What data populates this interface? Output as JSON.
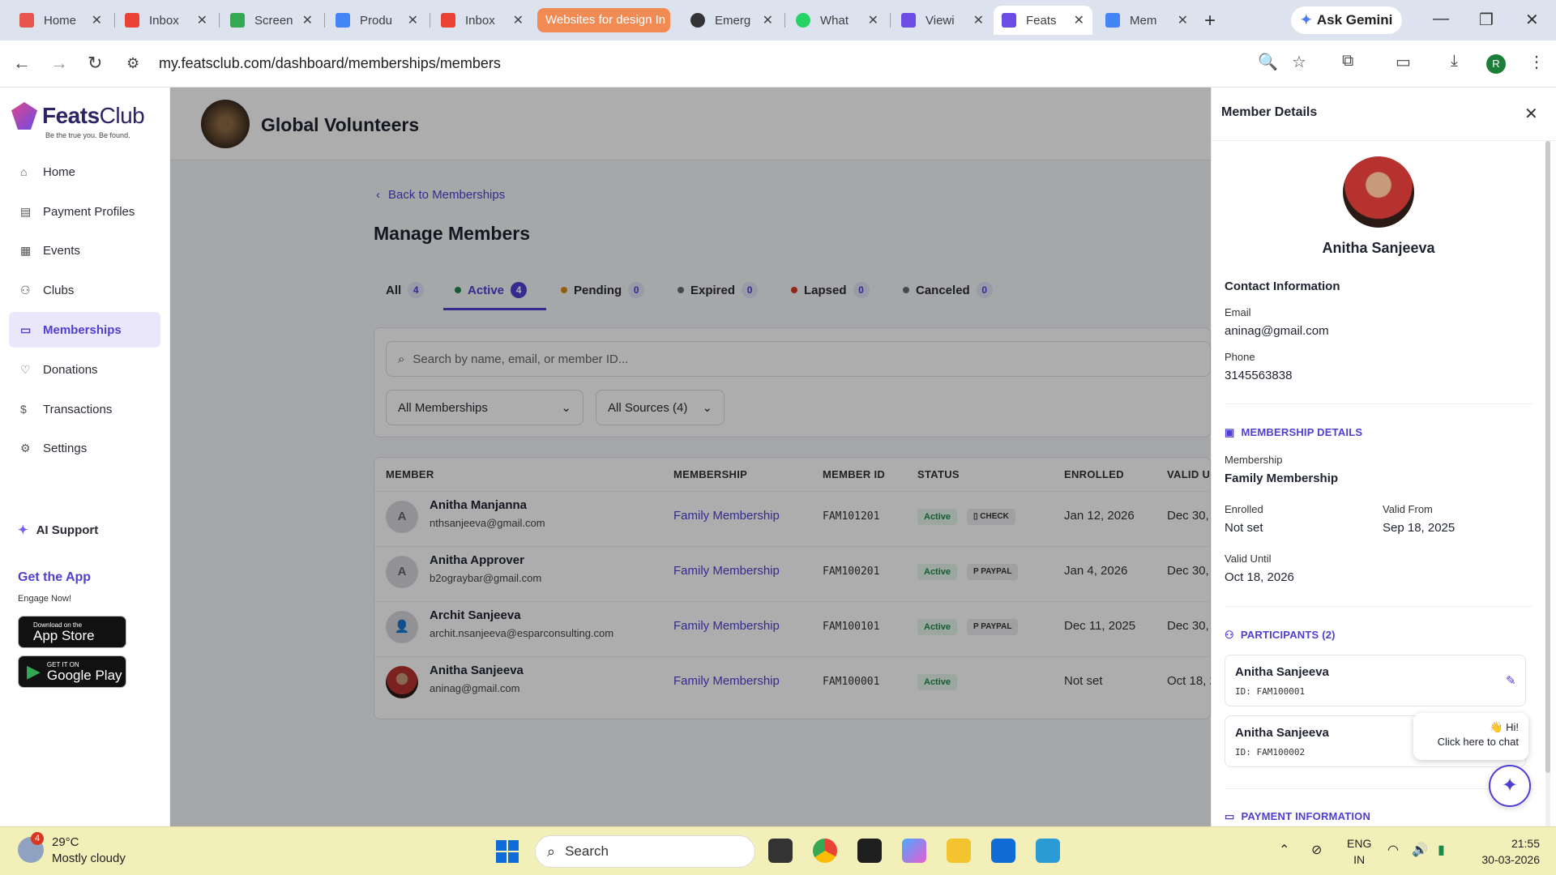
{
  "browser": {
    "tabs": [
      {
        "title": "Home",
        "color": "#e8554e"
      },
      {
        "title": "Inbox",
        "color": "#ea4335"
      },
      {
        "title": "Screen",
        "color": "#34a853"
      },
      {
        "title": "Produ",
        "color": "#4285f4"
      },
      {
        "title": "Inbox",
        "color": "#ea4335"
      },
      {
        "title": "Websites for design In",
        "color": "#f28b53"
      },
      {
        "title": "Emerg",
        "color": "#333333"
      },
      {
        "title": "What",
        "color": "#25d366"
      },
      {
        "title": "Viewi",
        "color": "#6b4de6"
      },
      {
        "title": "Feats",
        "color": "#6b4de6"
      },
      {
        "title": "Mem",
        "color": "#4285f4"
      }
    ],
    "gemini_label": "Ask Gemini",
    "url": "my.featsclub.com/dashboard/memberships/members",
    "profile_initial": "R"
  },
  "sidebar": {
    "brand_bold": "Feats",
    "brand_light": "Club",
    "tagline": "Be the true you. Be found.",
    "items": [
      {
        "label": "Home",
        "icon": "home-icon"
      },
      {
        "label": "Payment Profiles",
        "icon": "payment-icon"
      },
      {
        "label": "Events",
        "icon": "calendar-icon"
      },
      {
        "label": "Clubs",
        "icon": "users-icon"
      },
      {
        "label": "Memberships",
        "icon": "card-icon"
      },
      {
        "label": "Donations",
        "icon": "heart-icon"
      },
      {
        "label": "Transactions",
        "icon": "dollar-icon"
      },
      {
        "label": "Settings",
        "icon": "gear-icon"
      }
    ],
    "ai_support": "AI Support",
    "get_app": "Get the App",
    "engage": "Engage Now!",
    "appstore_small": "Download on the",
    "appstore_big": "App Store",
    "googleplay_small": "GET IT ON",
    "googleplay_big": "Google Play"
  },
  "org": {
    "name": "Global Volunteers"
  },
  "page": {
    "back_label": "Back to Memberships",
    "title": "Manage Members",
    "tabs": [
      {
        "label": "All",
        "count": "4",
        "dot": ""
      },
      {
        "label": "Active",
        "count": "4",
        "dot": "#1e8a4a"
      },
      {
        "label": "Pending",
        "count": "0",
        "dot": "#d88a1a"
      },
      {
        "label": "Expired",
        "count": "0",
        "dot": "#666a75"
      },
      {
        "label": "Lapsed",
        "count": "0",
        "dot": "#d9381e"
      },
      {
        "label": "Canceled",
        "count": "0",
        "dot": "#666a75"
      }
    ],
    "search_placeholder": "Search by name, email, or member ID...",
    "filter_memberships": "All Memberships",
    "filter_sources": "All Sources (4)"
  },
  "table": {
    "headers": [
      "MEMBER",
      "MEMBERSHIP",
      "MEMBER ID",
      "STATUS",
      "ENROLLED",
      "VALID U"
    ],
    "rows": [
      {
        "initial": "A",
        "name": "Anitha Manjanna",
        "email": "nthsanjeeva@gmail.com",
        "membership": "Family Membership",
        "id": "FAM101201",
        "status": "Active",
        "source": "CHECK",
        "enrolled": "Jan 12, 2026",
        "valid": "Dec 30,"
      },
      {
        "initial": "A",
        "name": "Anitha Approver",
        "email": "b2ograybar@gmail.com",
        "membership": "Family Membership",
        "id": "FAM100201",
        "status": "Active",
        "source": "PAYPAL",
        "enrolled": "Jan 4, 2026",
        "valid": "Dec 30,"
      },
      {
        "initial": "",
        "name": "Archit Sanjeeva",
        "email": "archit.nsanjeeva@esparconsulting.com",
        "membership": "Family Membership",
        "id": "FAM100101",
        "status": "Active",
        "source": "PAYPAL",
        "enrolled": "Dec 11, 2025",
        "valid": "Dec 30,"
      },
      {
        "initial": "",
        "name": "Anitha Sanjeeva",
        "email": "aninag@gmail.com",
        "membership": "Family Membership",
        "id": "FAM100001",
        "status": "Active",
        "source": "",
        "enrolled": "Not set",
        "valid": "Oct 18, 2"
      }
    ]
  },
  "panel": {
    "title": "Member Details",
    "name": "Anitha Sanjeeva",
    "contact_heading": "Contact Information",
    "email_label": "Email",
    "email": "aninag@gmail.com",
    "phone_label": "Phone",
    "phone": "3145563838",
    "membership_heading": "MEMBERSHIP DETAILS",
    "membership_label": "Membership",
    "membership": "Family Membership",
    "enrolled_label": "Enrolled",
    "enrolled": "Not set",
    "valid_from_label": "Valid From",
    "valid_from": "Sep 18, 2025",
    "valid_until_label": "Valid Until",
    "valid_until": "Oct 18, 2026",
    "participants_heading": "PARTICIPANTS (2)",
    "participants": [
      {
        "name": "Anitha Sanjeeva",
        "id": "ID: FAM100001"
      },
      {
        "name": "Anitha Sanjeeva",
        "id": "ID: FAM100002"
      }
    ],
    "payment_heading": "PAYMENT INFORMATION"
  },
  "chat": {
    "greeting": "👋 Hi!",
    "cta": "Click here to chat"
  },
  "taskbar": {
    "weather_badge": "4",
    "temp": "29°C",
    "condition": "Mostly cloudy",
    "search": "Search",
    "lang1": "ENG",
    "lang2": "IN",
    "time": "21:55",
    "date": "30-03-2026"
  }
}
